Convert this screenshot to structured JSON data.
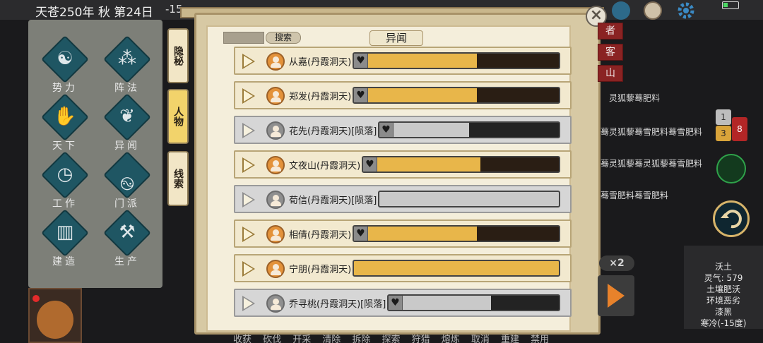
{
  "topbar": {
    "date": "天苍250年 秋 第24日",
    "temperature": "-15"
  },
  "left_menu": [
    {
      "label": "势力",
      "icon": "faction-icon",
      "glyph": "☯"
    },
    {
      "label": "阵法",
      "icon": "formation-icon",
      "glyph": "⁂"
    },
    {
      "label": "天下",
      "icon": "world-icon",
      "glyph": "✋"
    },
    {
      "label": "异闻",
      "icon": "butterfly-icon",
      "glyph": "❦"
    },
    {
      "label": "工作",
      "icon": "clock-icon",
      "glyph": "◷"
    },
    {
      "label": "门派",
      "icon": "sect-icon",
      "glyph": "࿊"
    },
    {
      "label": "建造",
      "icon": "build-icon",
      "glyph": "▥"
    },
    {
      "label": "生产",
      "icon": "hammer-icon",
      "glyph": "⚒"
    }
  ],
  "vertical_tabs": [
    {
      "label": "隐秘",
      "active": false
    },
    {
      "label": "人物",
      "active": true
    },
    {
      "label": "线索",
      "active": false
    }
  ],
  "panel": {
    "title": "异闻",
    "search_label": "搜索",
    "search_value": ""
  },
  "characters": [
    {
      "name": "从嘉(丹霞洞天)",
      "status": "alive",
      "affinity": 0.6,
      "has_heart": true
    },
    {
      "name": "郑发(丹霞洞天)",
      "status": "alive",
      "affinity": 0.6,
      "has_heart": true
    },
    {
      "name": "花先(丹霞洞天)[陨落]",
      "status": "dead",
      "affinity": 0.5,
      "has_heart": true
    },
    {
      "name": "文夜山(丹霞洞天)",
      "status": "alive",
      "affinity": 0.6,
      "has_heart": true
    },
    {
      "name": "荀信(丹霞洞天)[陨落]",
      "status": "dead",
      "affinity": 1.0,
      "has_heart": false
    },
    {
      "name": "相倩(丹霞洞天)",
      "status": "alive",
      "affinity": 0.6,
      "has_heart": true
    },
    {
      "name": "宁朋(丹霞洞天)",
      "status": "alive",
      "affinity": 1.0,
      "has_heart": false
    },
    {
      "name": "乔寻桃(丹霞洞天)[陨落]",
      "status": "dead",
      "affinity": 0.6,
      "has_heart": true
    }
  ],
  "right_panel": {
    "red_tabs": [
      "者",
      "客",
      "山"
    ],
    "log_lines": [
      "灵狐藜蓦肥料",
      "蓦灵狐藜蓦雪肥料蓦雪肥料",
      "蓦灵狐藜蓦灵狐藜蓦雪肥料",
      "蓦雪肥料蓦雪肥料"
    ],
    "badges": [
      "1",
      "3",
      "8"
    ],
    "speed": "×2",
    "tile_info": [
      "沃土",
      "灵气: 579",
      "土壤肥沃",
      "环境恶劣",
      "漆黑",
      "寒冷(-15度)"
    ]
  },
  "actions": [
    "收获",
    "砍伐",
    "开采",
    "清除",
    "拆除",
    "探索",
    "狩猎",
    "熔炼",
    "取消",
    "重建",
    "禁用"
  ]
}
